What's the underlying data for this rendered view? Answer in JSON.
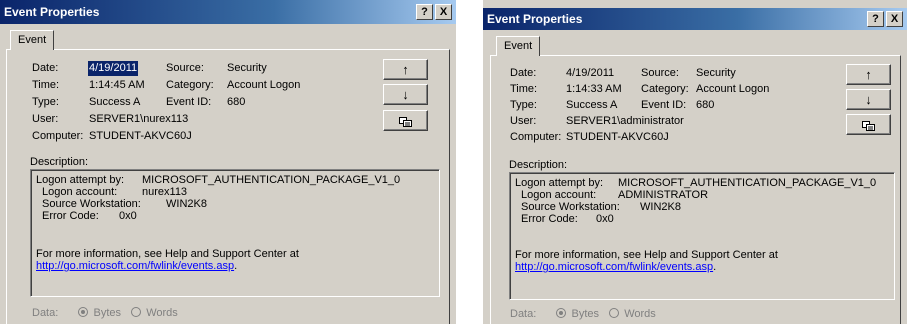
{
  "dialogs": [
    {
      "title": "Event Properties",
      "help_btn": "?",
      "close_btn": "X",
      "tab": "Event",
      "fields": {
        "date_label": "Date:",
        "date_value": "4/19/2011",
        "time_label": "Time:",
        "time_value": "1:14:45 AM",
        "type_label": "Type:",
        "type_value": "Success A",
        "user_label": "User:",
        "user_value": "SERVER1\\nurex113",
        "computer_label": "Computer:",
        "computer_value": "STUDENT-AKVC60J",
        "source_label": "Source:",
        "source_value": "Security",
        "category_label": "Category:",
        "category_value": "Account Logon",
        "eventid_label": "Event ID:",
        "eventid_value": "680"
      },
      "buttons": {
        "up": "↑",
        "down": "↓"
      },
      "description_label": "Description:",
      "description": {
        "l1_label": "Logon attempt by:",
        "l1_value": "MICROSOFT_AUTHENTICATION_PACKAGE_V1_0",
        "l2_label": "Logon account:",
        "l2_value": "nurex113",
        "l3_label": "Source Workstation:",
        "l3_value": "WIN2K8",
        "l4_label": "Error Code:",
        "l4_value": "0x0",
        "more_info": "For more information, see Help and Support Center at",
        "link": "http://go.microsoft.com/fwlink/events.asp",
        "link_tail": "."
      },
      "data": {
        "label": "Data:",
        "bytes": "Bytes",
        "words": "Words"
      }
    },
    {
      "title": "Event Properties",
      "help_btn": "?",
      "close_btn": "X",
      "tab": "Event",
      "fields": {
        "date_label": "Date:",
        "date_value": "4/19/2011",
        "time_label": "Time:",
        "time_value": "1:14:33 AM",
        "type_label": "Type:",
        "type_value": "Success A",
        "user_label": "User:",
        "user_value": "SERVER1\\administrator",
        "computer_label": "Computer:",
        "computer_value": "STUDENT-AKVC60J",
        "source_label": "Source:",
        "source_value": "Security",
        "category_label": "Category:",
        "category_value": "Account Logon",
        "eventid_label": "Event ID:",
        "eventid_value": "680"
      },
      "buttons": {
        "up": "↑",
        "down": "↓"
      },
      "description_label": "Description:",
      "description": {
        "l1_label": "Logon attempt by:",
        "l1_value": "MICROSOFT_AUTHENTICATION_PACKAGE_V1_0",
        "l2_label": "Logon account:",
        "l2_value": "ADMINISTRATOR",
        "l3_label": "Source Workstation:",
        "l3_value": "WIN2K8",
        "l4_label": "Error Code:",
        "l4_value": "0x0",
        "more_info": "For more information, see Help and Support Center at",
        "link": "http://go.microsoft.com/fwlink/events.asp",
        "link_tail": "."
      },
      "data": {
        "label": "Data:",
        "bytes": "Bytes",
        "words": "Words"
      }
    }
  ]
}
